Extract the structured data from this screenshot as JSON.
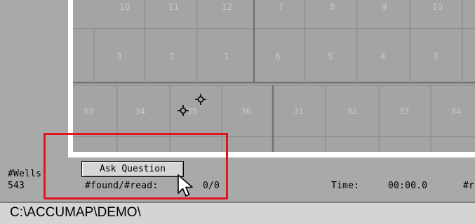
{
  "map": {
    "row1_sections": [
      "10",
      "11",
      "12",
      "7",
      "8",
      "9",
      "10"
    ],
    "row2_sections": [
      "3",
      "2",
      "1",
      "6",
      "5",
      "4",
      "3"
    ],
    "row3_sections": [
      "33",
      "34",
      "35",
      "36",
      "31",
      "32",
      "33",
      "34"
    ]
  },
  "controls": {
    "ask_button_label": "Ask Question"
  },
  "stats": {
    "wells_label": "#Wells",
    "wells_value": "543",
    "found_read_label": "#found/#read:",
    "found_read_value": "0/0",
    "time_label": "Time:",
    "time_value": "00:00.0",
    "cut_label": "#r"
  },
  "path_bar": {
    "path": "C:\\ACCUMAP\\DEMO\\"
  },
  "colors": {
    "highlight": "#e2141c",
    "map_fill": "#a4a4a4",
    "background": "#a9a9a9"
  }
}
